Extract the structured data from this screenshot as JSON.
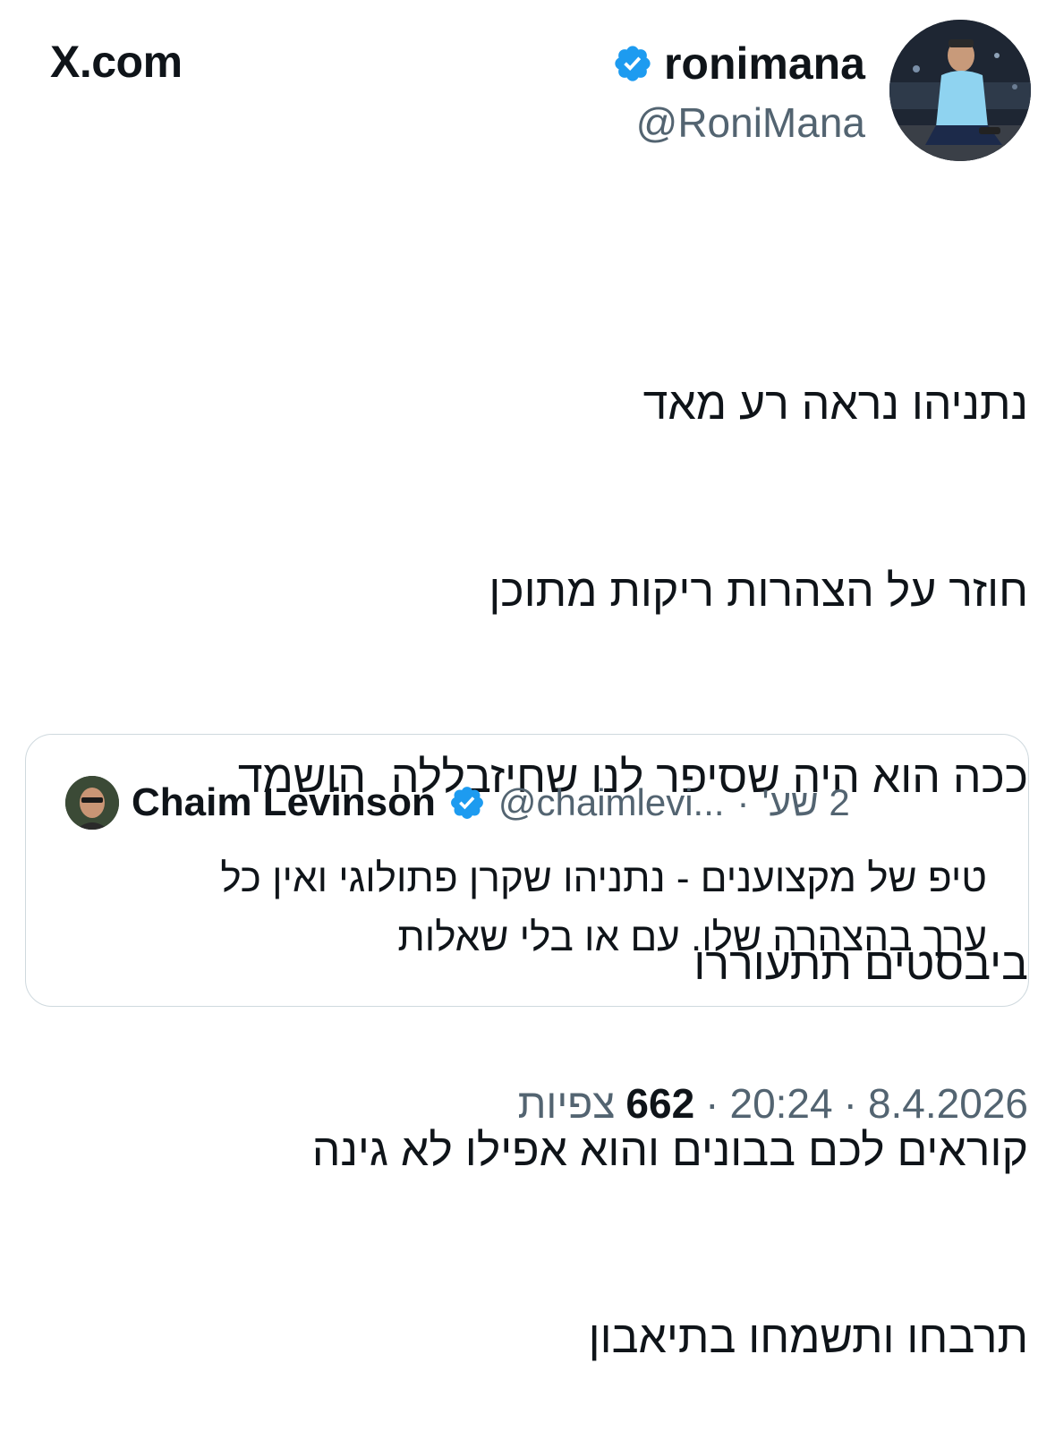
{
  "brand": {
    "label": "X.com"
  },
  "author": {
    "display_name": "ronimana",
    "handle": "@RoniMana",
    "verified": true,
    "verified_color": "#1d9bf0"
  },
  "tweet": {
    "lines": [
      "נתניהו נראה רע מאד",
      "חוזר על הצהרות ריקות מתוכן",
      "ככה הוא היה שסיפר לנו שחיזבללה  הושמד",
      "ביבסטים תתעוררו",
      "קוראים לכם בבונים והוא אפילו לא גינה",
      "תרבחו ותשמחו בתיאבון"
    ]
  },
  "quote": {
    "display_name": "Chaim Levinson",
    "handle": "@chaimlevi...",
    "separator": "·",
    "time": "2 שע'",
    "verified": true,
    "lines": [
      "טיפ של מקצוענים - נתניהו שקרן פתולוגי ואין כל",
      "ערך בהצהרה שלו. עם או בלי שאלות"
    ]
  },
  "meta": {
    "date": "8.4.2026",
    "separator": "·",
    "time": "20:24",
    "views_count": "662",
    "views_label": "צפיות"
  },
  "icons": [
    "x-logo-icon",
    "verified-badge-icon"
  ]
}
